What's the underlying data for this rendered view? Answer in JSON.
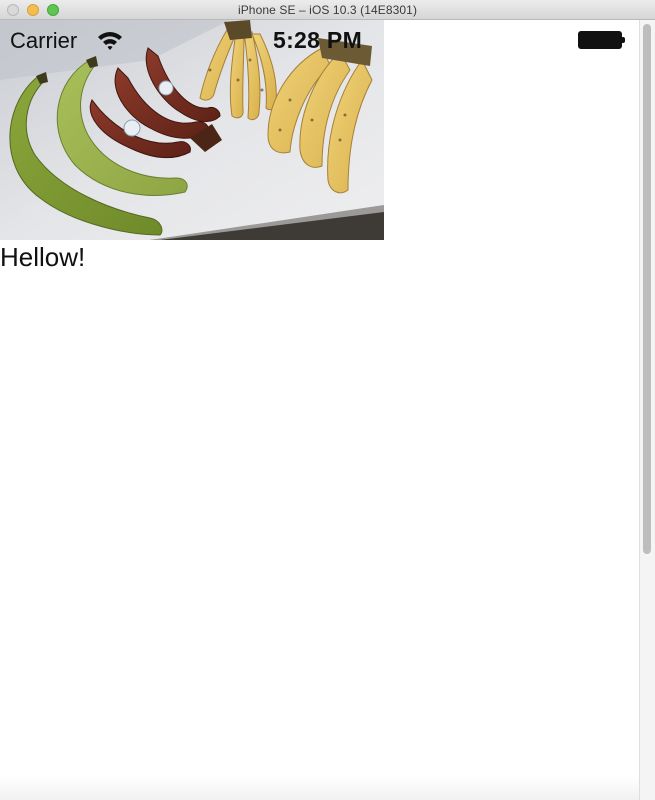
{
  "window": {
    "title": "iPhone SE – iOS 10.3 (14E8301)",
    "buttons": [
      "close",
      "minimize",
      "zoom"
    ]
  },
  "status_bar": {
    "carrier": "Carrier",
    "time": "5:28 PM",
    "icons": [
      "wifi-icon",
      "battery-icon"
    ]
  },
  "content": {
    "image": "bananas-photo",
    "label": "Hellow!"
  }
}
